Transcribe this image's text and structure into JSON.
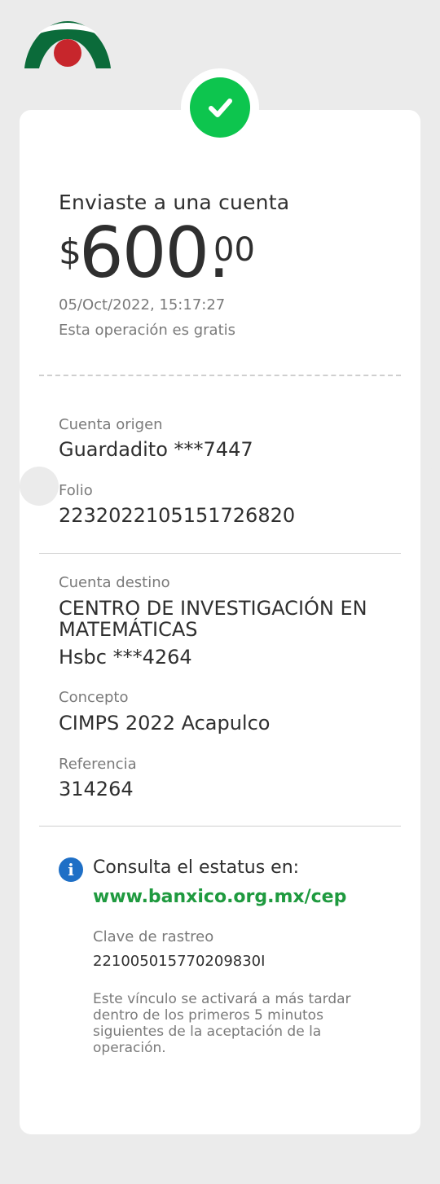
{
  "brand": {
    "logo_icon": "bank-logo-icon",
    "colors": {
      "green": "#0b6b3a",
      "red": "#c7262c",
      "success": "#0dc54e",
      "info": "#1e6fc6",
      "link": "#1f9a3f"
    }
  },
  "status": {
    "icon": "check-icon"
  },
  "summary": {
    "title": "Enviaste a una cuenta",
    "currency": "$",
    "amount_int": "600.",
    "amount_dec": "00",
    "datetime": "05/Oct/2022, 15:17:27",
    "fee_note": "Esta operación es gratis"
  },
  "origin": {
    "account_label": "Cuenta origen",
    "account_value": "Guardadito ***7447",
    "folio_label": "Folio",
    "folio_value": "2232022105151726820"
  },
  "destination": {
    "account_label": "Cuenta destino",
    "name_line1": "CENTRO DE INVESTIGACIÓN EN",
    "name_line2": "MATEMÁTICAS",
    "bank_account": "Hsbc ***4264",
    "concept_label": "Concepto",
    "concept_value": "CIMPS 2022 Acapulco",
    "reference_label": "Referencia",
    "reference_value": "314264"
  },
  "status_check": {
    "info_icon": "info-icon",
    "info_glyph": "i",
    "consult_text": "Consulta el estatus en:",
    "link_text": "www.banxico.org.mx/cep",
    "tracking_label": "Clave de rastreo",
    "tracking_value": "221005015770209830I",
    "note": "Este vínculo se activará a más tardar dentro de los primeros 5 minutos siguientes de la aceptación de la operación."
  }
}
